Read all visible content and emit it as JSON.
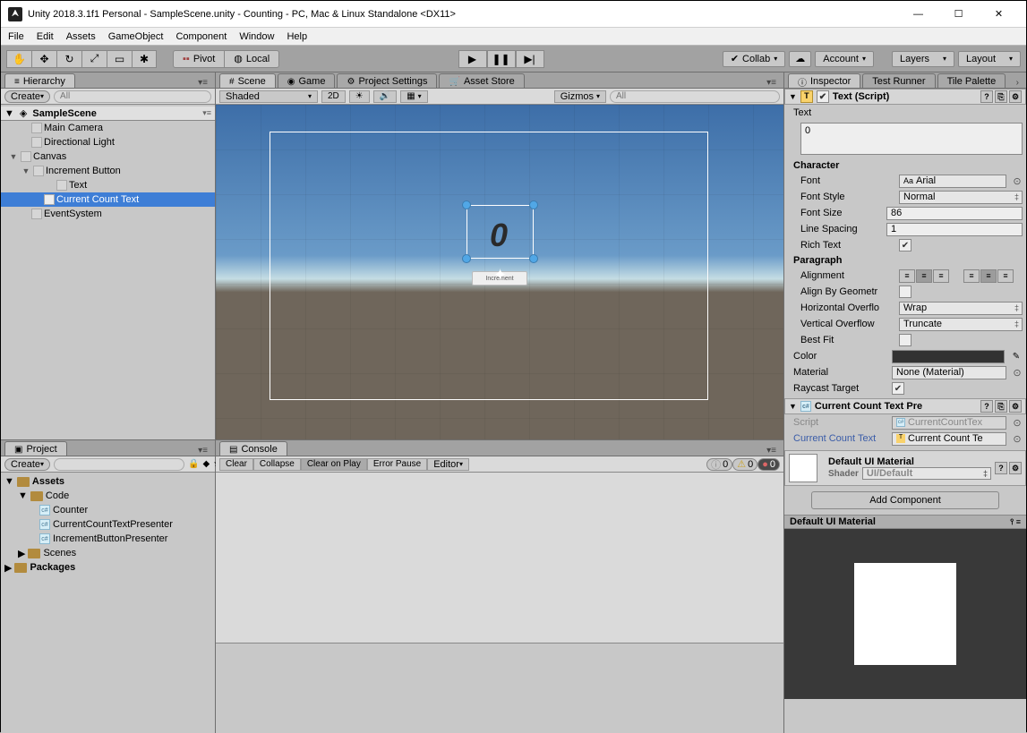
{
  "window_title": "Unity 2018.3.1f1 Personal - SampleScene.unity - Counting - PC, Mac & Linux Standalone <DX11>",
  "menu": [
    "File",
    "Edit",
    "Assets",
    "GameObject",
    "Component",
    "Window",
    "Help"
  ],
  "toolbar": {
    "pivot": "Pivot",
    "local": "Local",
    "collab": "Collab",
    "account": "Account",
    "layers": "Layers",
    "layout": "Layout"
  },
  "hierarchy": {
    "tab": "Hierarchy",
    "create": "Create",
    "search_placeholder": "All",
    "scene": "SampleScene",
    "items": [
      {
        "depth": 1,
        "label": "Main Camera"
      },
      {
        "depth": 1,
        "label": "Directional Light"
      },
      {
        "depth": 1,
        "label": "Canvas",
        "expanded": true
      },
      {
        "depth": 2,
        "label": "Increment Button",
        "expanded": true
      },
      {
        "depth": 3,
        "label": "Text"
      },
      {
        "depth": 2,
        "label": "Current Count Text",
        "selected": true
      },
      {
        "depth": 1,
        "label": "EventSystem"
      }
    ]
  },
  "project": {
    "tab": "Project",
    "create": "Create",
    "tree": [
      {
        "type": "folder",
        "depth": 0,
        "label": "Assets",
        "expanded": true
      },
      {
        "type": "folder",
        "depth": 1,
        "label": "Code",
        "expanded": true
      },
      {
        "type": "script",
        "depth": 2,
        "label": "Counter"
      },
      {
        "type": "script",
        "depth": 2,
        "label": "CurrentCountTextPresenter"
      },
      {
        "type": "script",
        "depth": 2,
        "label": "IncrementButtonPresenter"
      },
      {
        "type": "folder",
        "depth": 1,
        "label": "Scenes"
      },
      {
        "type": "folder",
        "depth": 0,
        "label": "Packages"
      }
    ]
  },
  "scene": {
    "tabs": [
      "Scene",
      "Game",
      "Project Settings",
      "Asset Store"
    ],
    "shading": "Shaded",
    "twod": "2D",
    "gizmos": "Gizmos",
    "search_placeholder": "All",
    "display_digit": "0",
    "button_label": "Increment"
  },
  "console": {
    "tab": "Console",
    "buttons": [
      "Clear",
      "Collapse",
      "Clear on Play",
      "Error Pause",
      "Editor"
    ],
    "counts": [
      "0",
      "0",
      "0"
    ]
  },
  "inspector": {
    "tabs": [
      "Inspector",
      "Test Runner",
      "Tile Palette"
    ],
    "text_component": {
      "title": "Text (Script)",
      "text_label": "Text",
      "text_value": "0",
      "character": "Character",
      "font_label": "Font",
      "font_value": "Arial",
      "fontstyle_label": "Font Style",
      "fontstyle_value": "Normal",
      "fontsize_label": "Font Size",
      "fontsize_value": "86",
      "linespacing_label": "Line Spacing",
      "linespacing_value": "1",
      "richtext_label": "Rich Text",
      "paragraph": "Paragraph",
      "alignment_label": "Alignment",
      "aligngeom_label": "Align By Geometr",
      "hoverflow_label": "Horizontal Overflo",
      "hoverflow_value": "Wrap",
      "voverflow_label": "Vertical Overflow",
      "voverflow_value": "Truncate",
      "bestfit_label": "Best Fit",
      "color_label": "Color",
      "material_label": "Material",
      "material_value": "None (Material)",
      "raycast_label": "Raycast Target"
    },
    "presenter_component": {
      "title": "Current Count Text Pre",
      "script_label": "Script",
      "script_value": "CurrentCountTex",
      "field_label": "Current Count Text",
      "field_value": "Current Count Te"
    },
    "material": {
      "name": "Default UI Material",
      "shader_label": "Shader",
      "shader_value": "UI/Default"
    },
    "add_component": "Add Component",
    "preview_title": "Default UI Material"
  }
}
